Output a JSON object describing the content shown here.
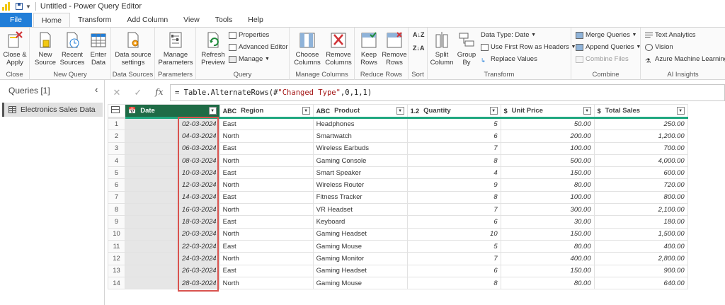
{
  "window": {
    "title": "Untitled - Power Query Editor"
  },
  "tabs": [
    "File",
    "Home",
    "Transform",
    "Add Column",
    "View",
    "Tools",
    "Help"
  ],
  "ribbon": {
    "close": {
      "button": "Close &\nApply",
      "group": "Close"
    },
    "new_query": {
      "new_source": "New\nSource",
      "recent_sources": "Recent\nSources",
      "enter_data": "Enter\nData",
      "group": "New Query"
    },
    "data_sources": {
      "settings": "Data source\nsettings",
      "group": "Data Sources"
    },
    "parameters": {
      "manage": "Manage\nParameters",
      "group": "Parameters"
    },
    "query": {
      "refresh": "Refresh\nPreview",
      "properties": "Properties",
      "advanced_editor": "Advanced Editor",
      "manage": "Manage",
      "group": "Query"
    },
    "manage_columns": {
      "choose": "Choose\nColumns",
      "remove": "Remove\nColumns",
      "group": "Manage Columns"
    },
    "reduce_rows": {
      "keep": "Keep\nRows",
      "remove": "Remove\nRows",
      "group": "Reduce Rows"
    },
    "sort": {
      "group": "Sort"
    },
    "transform": {
      "split": "Split\nColumn",
      "group_by": "Group\nBy",
      "data_type": "Data Type: Date",
      "first_row": "Use First Row as Headers",
      "replace": "Replace Values",
      "group": "Transform"
    },
    "combine": {
      "merge": "Merge Queries",
      "append": "Append Queries",
      "combine_files": "Combine Files",
      "group": "Combine"
    },
    "ai": {
      "text_analytics": "Text Analytics",
      "vision": "Vision",
      "azure_ml": "Azure Machine Learning",
      "group": "AI Insights"
    }
  },
  "queries": {
    "header": "Queries [1]",
    "items": [
      "Electronics Sales Data"
    ]
  },
  "formula": {
    "prefix": "= Table.AlternateRows(#",
    "str": "\"Changed Type\"",
    "args": ",0,1,1)"
  },
  "columns": [
    {
      "type": "📅",
      "name": "Date"
    },
    {
      "type": "ABC",
      "name": "Region"
    },
    {
      "type": "ABC",
      "name": "Product"
    },
    {
      "type": "1.2",
      "name": "Quantity"
    },
    {
      "type": "$",
      "name": "Unit Price"
    },
    {
      "type": "$",
      "name": "Total Sales"
    }
  ],
  "rows": [
    [
      "1",
      "02-03-2024",
      "East",
      "Headphones",
      "5",
      "50.00",
      "250.00"
    ],
    [
      "2",
      "04-03-2024",
      "North",
      "Smartwatch",
      "6",
      "200.00",
      "1,200.00"
    ],
    [
      "3",
      "06-03-2024",
      "East",
      "Wireless Earbuds",
      "7",
      "100.00",
      "700.00"
    ],
    [
      "4",
      "08-03-2024",
      "North",
      "Gaming Console",
      "8",
      "500.00",
      "4,000.00"
    ],
    [
      "5",
      "10-03-2024",
      "East",
      "Smart Speaker",
      "4",
      "150.00",
      "600.00"
    ],
    [
      "6",
      "12-03-2024",
      "North",
      "Wireless Router",
      "9",
      "80.00",
      "720.00"
    ],
    [
      "7",
      "14-03-2024",
      "East",
      "Fitness Tracker",
      "8",
      "100.00",
      "800.00"
    ],
    [
      "8",
      "16-03-2024",
      "North",
      "VR Headset",
      "7",
      "300.00",
      "2,100.00"
    ],
    [
      "9",
      "18-03-2024",
      "East",
      "Keyboard",
      "6",
      "30.00",
      "180.00"
    ],
    [
      "10",
      "20-03-2024",
      "North",
      "Gaming Headset",
      "10",
      "150.00",
      "1,500.00"
    ],
    [
      "11",
      "22-03-2024",
      "East",
      "Gaming Mouse",
      "5",
      "80.00",
      "400.00"
    ],
    [
      "12",
      "24-03-2024",
      "North",
      "Gaming Monitor",
      "7",
      "400.00",
      "2,800.00"
    ],
    [
      "13",
      "26-03-2024",
      "East",
      "Gaming Headset",
      "6",
      "150.00",
      "900.00"
    ],
    [
      "14",
      "28-03-2024",
      "North",
      "Gaming Mouse",
      "8",
      "80.00",
      "640.00"
    ]
  ],
  "colors": {
    "file_tab": "#217ed8",
    "selected_header": "#1f6b46",
    "accent_line": "#21a880",
    "highlight_box": "#d9534f"
  }
}
